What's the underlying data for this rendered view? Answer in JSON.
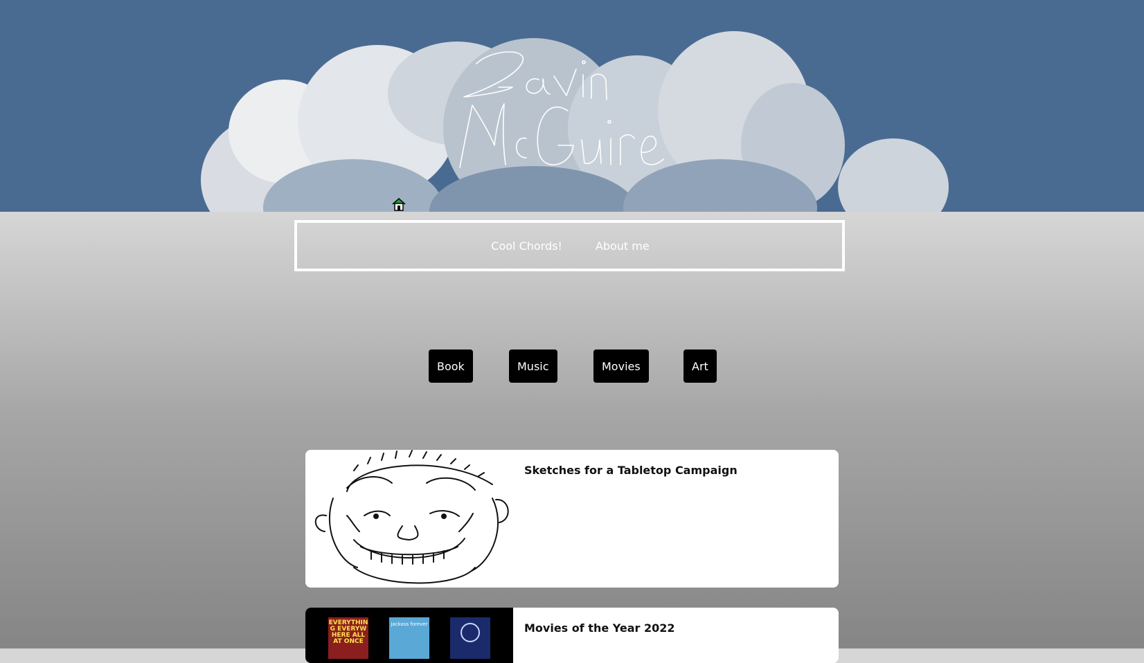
{
  "header": {
    "signature_name": "Gavin McGuire",
    "home_icon": "home-icon",
    "sky_color": "#4a6b91"
  },
  "nav": {
    "items": [
      {
        "label": "Cool Chords!"
      },
      {
        "label": "About me"
      }
    ]
  },
  "filters": {
    "buttons": [
      {
        "label": "Book"
      },
      {
        "label": "Music"
      },
      {
        "label": "Movies"
      },
      {
        "label": "Art"
      }
    ]
  },
  "cards": [
    {
      "title": "Sketches for a Tabletop Campaign",
      "image": "smiling-face-sketch"
    },
    {
      "title": "Movies of the Year 2022",
      "image": "movie-posters",
      "posters": [
        "EVERYTHING EVERYWHERE ALL AT ONCE",
        "jackass forever",
        ""
      ]
    }
  ]
}
